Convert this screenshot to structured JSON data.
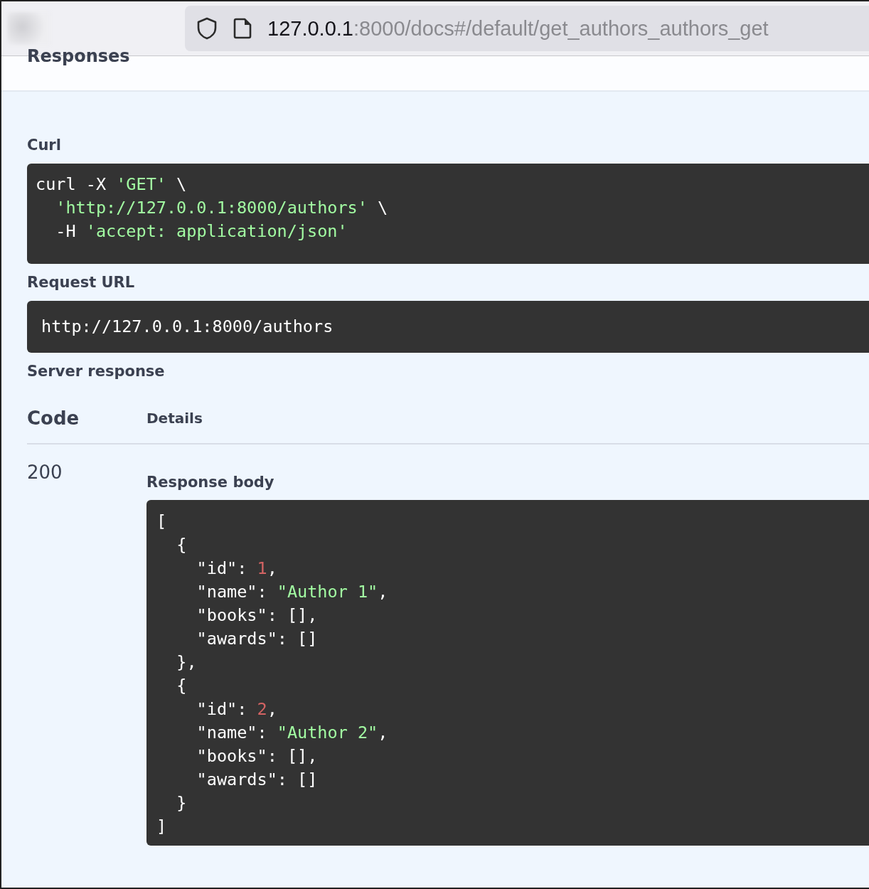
{
  "browser": {
    "url_host": "127.0.0.1",
    "url_rest": ":8000/docs#/default/get_authors_authors_get"
  },
  "section_title": "Responses",
  "curl": {
    "label": "Curl",
    "lines": [
      [
        {
          "kind": "plain",
          "text": "curl -X "
        },
        {
          "kind": "string",
          "text": "'GET'"
        },
        {
          "kind": "plain",
          "text": " \\"
        }
      ],
      [
        {
          "kind": "string",
          "text": "  'http://127.0.0.1:8000/authors'"
        },
        {
          "kind": "plain",
          "text": " \\"
        }
      ],
      [
        {
          "kind": "plain",
          "text": "  -H "
        },
        {
          "kind": "string",
          "text": "'accept: application/json'"
        }
      ]
    ]
  },
  "request_url": {
    "label": "Request URL",
    "value": "http://127.0.0.1:8000/authors"
  },
  "server_response": {
    "label": "Server response",
    "columns": [
      "Code",
      "Details"
    ],
    "code": "200",
    "body_label": "Response body",
    "body_lines": [
      [
        {
          "kind": "plain",
          "text": "["
        }
      ],
      [
        {
          "kind": "plain",
          "text": "  {"
        }
      ],
      [
        {
          "kind": "plain",
          "text": "    \"id\": "
        },
        {
          "kind": "number",
          "text": "1"
        },
        {
          "kind": "plain",
          "text": ","
        }
      ],
      [
        {
          "kind": "plain",
          "text": "    \"name\": "
        },
        {
          "kind": "string",
          "text": "\"Author 1\""
        },
        {
          "kind": "plain",
          "text": ","
        }
      ],
      [
        {
          "kind": "plain",
          "text": "    \"books\": [],"
        }
      ],
      [
        {
          "kind": "plain",
          "text": "    \"awards\": []"
        }
      ],
      [
        {
          "kind": "plain",
          "text": "  },"
        }
      ],
      [
        {
          "kind": "plain",
          "text": "  {"
        }
      ],
      [
        {
          "kind": "plain",
          "text": "    \"id\": "
        },
        {
          "kind": "number",
          "text": "2"
        },
        {
          "kind": "plain",
          "text": ","
        }
      ],
      [
        {
          "kind": "plain",
          "text": "    \"name\": "
        },
        {
          "kind": "string",
          "text": "\"Author 2\""
        },
        {
          "kind": "plain",
          "text": ","
        }
      ],
      [
        {
          "kind": "plain",
          "text": "    \"books\": [],"
        }
      ],
      [
        {
          "kind": "plain",
          "text": "    \"awards\": []"
        }
      ],
      [
        {
          "kind": "plain",
          "text": "  }"
        }
      ],
      [
        {
          "kind": "plain",
          "text": "]"
        }
      ]
    ]
  }
}
